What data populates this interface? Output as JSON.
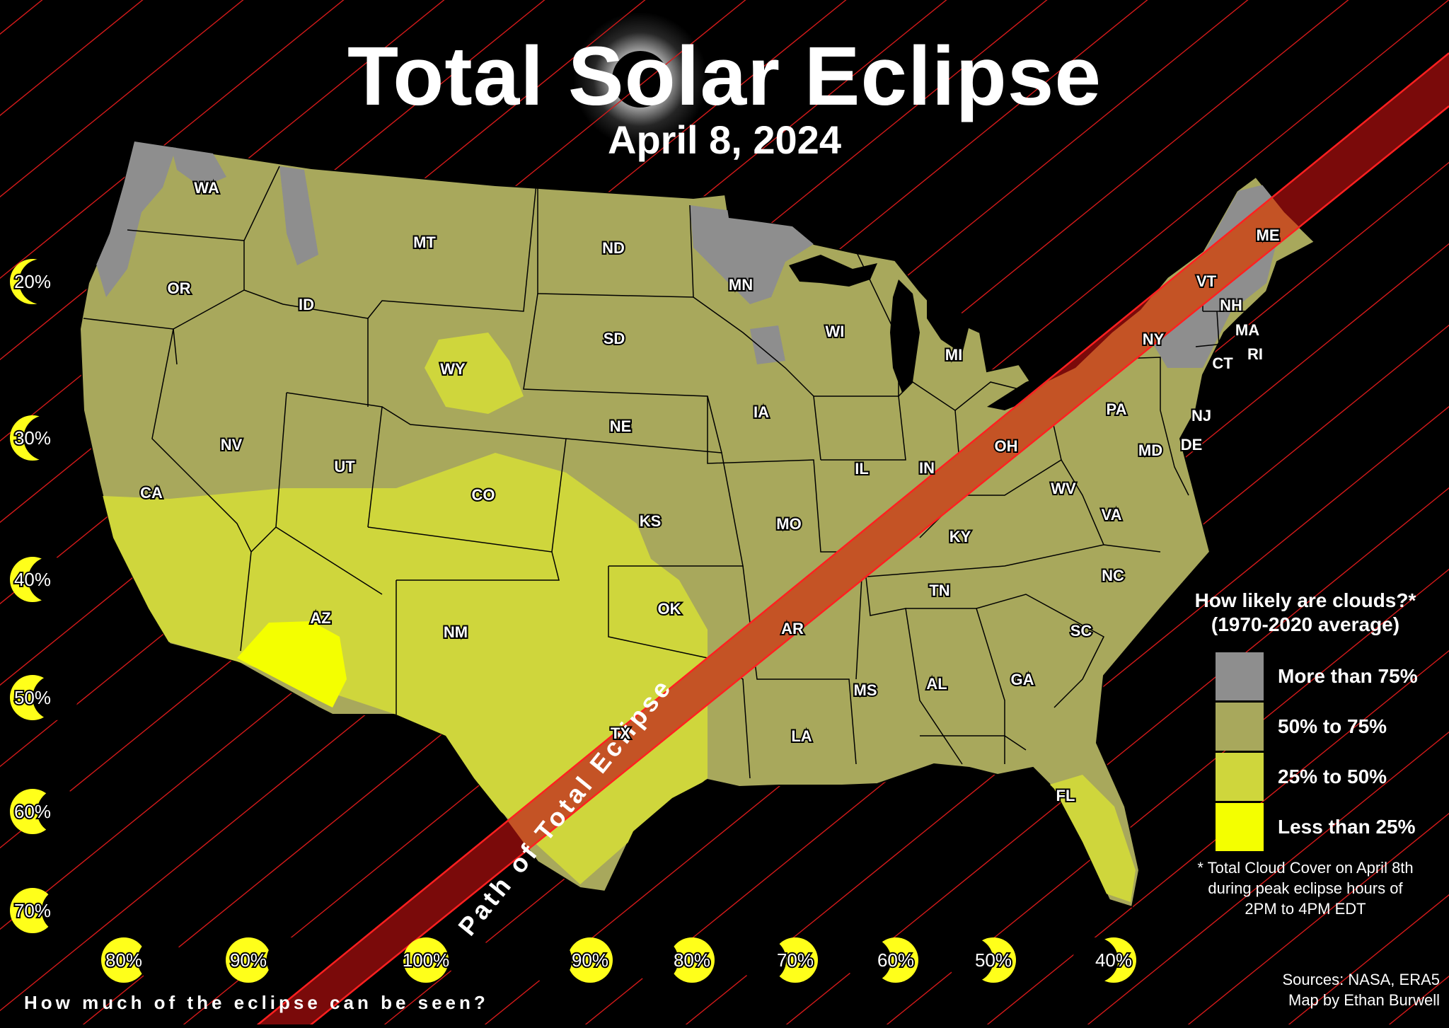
{
  "header": {
    "title": "Total Solar Eclipse",
    "date": "April 8, 2024"
  },
  "path_label": "Path of Total Eclipse",
  "states": [
    {
      "abbr": "WA"
    },
    {
      "abbr": "OR"
    },
    {
      "abbr": "CA"
    },
    {
      "abbr": "NV"
    },
    {
      "abbr": "ID"
    },
    {
      "abbr": "MT"
    },
    {
      "abbr": "WY"
    },
    {
      "abbr": "UT"
    },
    {
      "abbr": "AZ"
    },
    {
      "abbr": "CO"
    },
    {
      "abbr": "NM"
    },
    {
      "abbr": "ND"
    },
    {
      "abbr": "SD"
    },
    {
      "abbr": "NE"
    },
    {
      "abbr": "KS"
    },
    {
      "abbr": "OK"
    },
    {
      "abbr": "TX"
    },
    {
      "abbr": "MN"
    },
    {
      "abbr": "IA"
    },
    {
      "abbr": "MO"
    },
    {
      "abbr": "AR"
    },
    {
      "abbr": "LA"
    },
    {
      "abbr": "WI"
    },
    {
      "abbr": "IL"
    },
    {
      "abbr": "MS"
    },
    {
      "abbr": "MI"
    },
    {
      "abbr": "IN"
    },
    {
      "abbr": "KY"
    },
    {
      "abbr": "TN"
    },
    {
      "abbr": "AL"
    },
    {
      "abbr": "OH"
    },
    {
      "abbr": "WV"
    },
    {
      "abbr": "VA"
    },
    {
      "abbr": "NC"
    },
    {
      "abbr": "SC"
    },
    {
      "abbr": "GA"
    },
    {
      "abbr": "FL"
    },
    {
      "abbr": "PA"
    },
    {
      "abbr": "NY"
    },
    {
      "abbr": "VT"
    },
    {
      "abbr": "NH"
    },
    {
      "abbr": "ME"
    },
    {
      "abbr": "MA"
    },
    {
      "abbr": "CT"
    },
    {
      "abbr": "RI"
    },
    {
      "abbr": "NJ"
    },
    {
      "abbr": "DE"
    },
    {
      "abbr": "MD"
    }
  ],
  "legend": {
    "title_line1": "How likely are clouds?*",
    "title_line2": "(1970-2020 average)",
    "items": [
      {
        "label": "More than 75%",
        "color": "#8e8e8e"
      },
      {
        "label": "50% to 75%",
        "color": "#a8a85c"
      },
      {
        "label": "25% to 50%",
        "color": "#cfd63c"
      },
      {
        "label": "Less than 25%",
        "color": "#f4ff00"
      }
    ]
  },
  "note": {
    "line1": "* Total Cloud Cover on April 8th",
    "line2": "during peak eclipse hours of",
    "line3": "2PM to 4PM EDT"
  },
  "credits": {
    "sources": "Sources: NASA, ERA5",
    "author": "Map by Ethan Burwell"
  },
  "coverage": {
    "question": "How much of the eclipse can be seen?",
    "left_markers": [
      {
        "label": "20%",
        "value": 20
      },
      {
        "label": "30%",
        "value": 30
      },
      {
        "label": "40%",
        "value": 40
      },
      {
        "label": "50%",
        "value": 50
      },
      {
        "label": "60%",
        "value": 60
      },
      {
        "label": "70%",
        "value": 70
      }
    ],
    "bottom_markers": [
      {
        "label": "80%",
        "value": 80
      },
      {
        "label": "90%",
        "value": 90
      },
      {
        "label": "100%",
        "value": 100
      },
      {
        "label": "90%",
        "value": 90
      },
      {
        "label": "80%",
        "value": 80
      },
      {
        "label": "70%",
        "value": 70
      },
      {
        "label": "60%",
        "value": 60
      },
      {
        "label": "50%",
        "value": 50
      },
      {
        "label": "40%",
        "value": 40
      }
    ]
  },
  "colors": {
    "background": "#000000",
    "band_lines": "#d41a1a",
    "totality_path": "#7a0a0a",
    "totality_overlay": "#e07030",
    "sun_corona": "#ffffff"
  }
}
